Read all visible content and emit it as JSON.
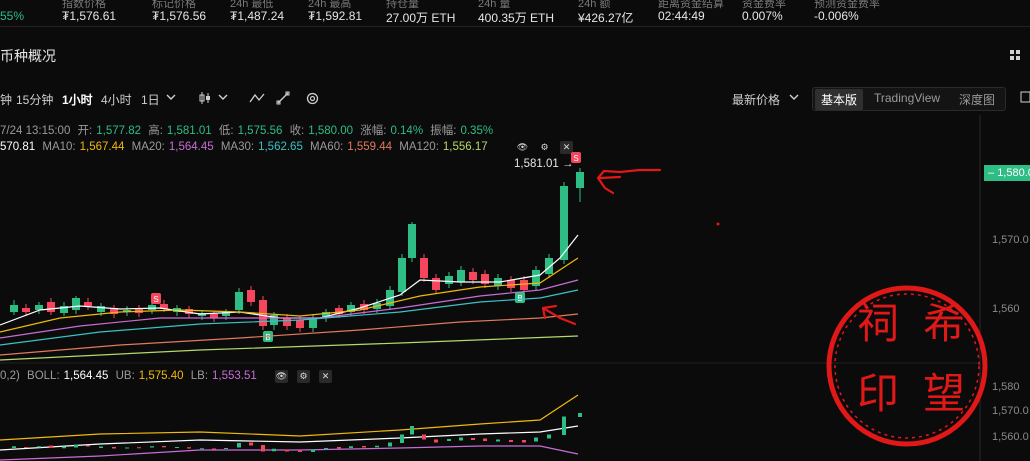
{
  "stats": [
    {
      "label": "",
      "value": "55%",
      "color": "#2ebd85"
    },
    {
      "label": "指数价格",
      "value": "₮1,576.61"
    },
    {
      "label": "标记价格",
      "value": "₮1,576.56"
    },
    {
      "label": "24h 最低",
      "value": "₮1,487.24"
    },
    {
      "label": "24h 最高",
      "value": "₮1,592.81"
    },
    {
      "label": "持仓量",
      "value": "27.00万 ETH"
    },
    {
      "label": "24h 量",
      "value": "400.35万 ETH"
    },
    {
      "label": "24h 额",
      "value": "¥426.27亿"
    },
    {
      "label": "距离资金结算",
      "value": "02:44:49"
    },
    {
      "label": "资金费率",
      "value": "0.007%"
    },
    {
      "label": "预测资金费率",
      "value": "-0.006%"
    }
  ],
  "section_title": "币种概况",
  "toolbar": {
    "intervals": [
      "钟",
      "15分钟",
      "1小时",
      "4小时",
      "1日"
    ],
    "active_interval": "1小时",
    "price_type": "最新价格",
    "views": [
      "基本版",
      "TradingView",
      "深度图"
    ],
    "active_view": "基本版"
  },
  "candle_info": {
    "time": "7/24 13:15:00",
    "open_label": "开:",
    "open": "1,577.82",
    "high_label": "高:",
    "high": "1,581.01",
    "low_label": "低:",
    "low": "1,575.56",
    "close_label": "收:",
    "close": "1,580.00",
    "change_label": "涨幅:",
    "change": "0.14%",
    "amp_label": "振幅:",
    "amp": "0.35%"
  },
  "ma": [
    {
      "name": "",
      "value": "570.81",
      "color": "#ffffff"
    },
    {
      "name": "MA10:",
      "value": "1,567.44",
      "color": "#f0b90b"
    },
    {
      "name": "MA20:",
      "value": "1,564.45",
      "color": "#c86dd7"
    },
    {
      "name": "MA30:",
      "value": "1,562.65",
      "color": "#3bc1c4"
    },
    {
      "name": "MA60:",
      "value": "1,559.44",
      "color": "#e07a5f"
    },
    {
      "name": "MA120:",
      "value": "1,556.17",
      "color": "#b5d96b"
    }
  ],
  "boll": {
    "prefix": "0,2)",
    "boll_label": "BOLL:",
    "boll": "1,564.45",
    "ub_label": "UB:",
    "ub": "1,575.40",
    "lb_label": "LB:",
    "lb": "1,553.51"
  },
  "high_marker": "1,581.01",
  "last_price": "1,580.0",
  "axis": [
    "1,570.0",
    "1,560",
    "1,580",
    "1,570.0",
    "1,560.0"
  ],
  "seal": {
    "text": "祠希印望",
    "color": "#e01818"
  },
  "colors": {
    "up": "#2ebd85",
    "down": "#f6465d"
  }
}
